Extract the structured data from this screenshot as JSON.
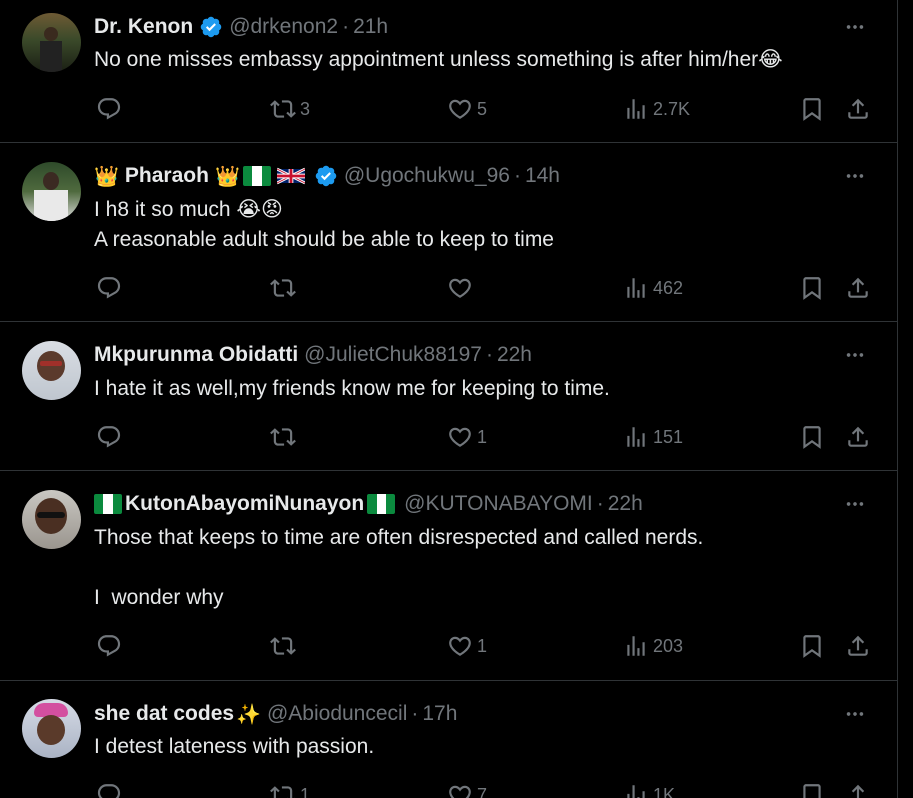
{
  "tweets": [
    {
      "name": "Dr. Kenon",
      "handle": "@drkenon2",
      "time": "21h",
      "text": "No one misses embassy appointment unless something is after him/her",
      "emoji_suffix": "😂",
      "replies": "",
      "retweets": "3",
      "likes": "5",
      "views": "2.7K"
    },
    {
      "name": "Pharaoh",
      "handle": "@Ugochukwu_96",
      "time": "14h",
      "text": "I h8 it so much",
      "text2": "A reasonable adult should be able to keep to time",
      "emoji_suffix": "😭😡",
      "replies": "",
      "retweets": "",
      "likes": "",
      "views": "462"
    },
    {
      "name": "Mkpurunma Obidatti",
      "handle": "@JulietChuk88197",
      "time": "22h",
      "text": "I hate it as well,my friends know me for keeping to time.",
      "replies": "",
      "retweets": "",
      "likes": "1",
      "views": "151"
    },
    {
      "name": "KutonAbayomiNunayon",
      "handle": "@KUTONABAYOMI",
      "time": "22h",
      "text": "Those that keeps to time are often disrespected and called nerds.",
      "text2": "I  wonder why",
      "replies": "",
      "retweets": "",
      "likes": "1",
      "views": "203"
    },
    {
      "name": "she dat codes",
      "handle": "@Abioduncecil",
      "time": "17h",
      "text": "I detest lateness with passion.",
      "replies": "",
      "retweets": "1",
      "likes": "7",
      "views": "1K"
    }
  ],
  "icons": {
    "reply": "reply-icon",
    "retweet": "retweet-icon",
    "like": "heart-icon",
    "views": "views-icon",
    "bookmark": "bookmark-icon",
    "share": "share-icon",
    "more": "more-icon",
    "verified": "verified-badge-icon"
  },
  "colors": {
    "background": "#000000",
    "text": "#e7e9ea",
    "muted": "#71767b",
    "verified": "#1d9bf0",
    "divider": "#2f3336"
  }
}
